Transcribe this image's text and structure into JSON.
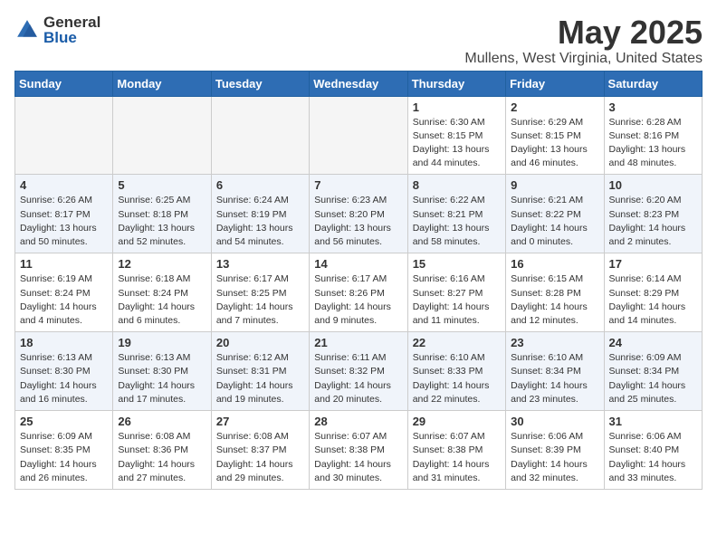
{
  "header": {
    "logo_general": "General",
    "logo_blue": "Blue",
    "month_title": "May 2025",
    "location": "Mullens, West Virginia, United States"
  },
  "days_of_week": [
    "Sunday",
    "Monday",
    "Tuesday",
    "Wednesday",
    "Thursday",
    "Friday",
    "Saturday"
  ],
  "weeks": [
    {
      "alt": false,
      "days": [
        {
          "num": "",
          "info": ""
        },
        {
          "num": "",
          "info": ""
        },
        {
          "num": "",
          "info": ""
        },
        {
          "num": "",
          "info": ""
        },
        {
          "num": "1",
          "info": "Sunrise: 6:30 AM\nSunset: 8:15 PM\nDaylight: 13 hours\nand 44 minutes."
        },
        {
          "num": "2",
          "info": "Sunrise: 6:29 AM\nSunset: 8:15 PM\nDaylight: 13 hours\nand 46 minutes."
        },
        {
          "num": "3",
          "info": "Sunrise: 6:28 AM\nSunset: 8:16 PM\nDaylight: 13 hours\nand 48 minutes."
        }
      ]
    },
    {
      "alt": true,
      "days": [
        {
          "num": "4",
          "info": "Sunrise: 6:26 AM\nSunset: 8:17 PM\nDaylight: 13 hours\nand 50 minutes."
        },
        {
          "num": "5",
          "info": "Sunrise: 6:25 AM\nSunset: 8:18 PM\nDaylight: 13 hours\nand 52 minutes."
        },
        {
          "num": "6",
          "info": "Sunrise: 6:24 AM\nSunset: 8:19 PM\nDaylight: 13 hours\nand 54 minutes."
        },
        {
          "num": "7",
          "info": "Sunrise: 6:23 AM\nSunset: 8:20 PM\nDaylight: 13 hours\nand 56 minutes."
        },
        {
          "num": "8",
          "info": "Sunrise: 6:22 AM\nSunset: 8:21 PM\nDaylight: 13 hours\nand 58 minutes."
        },
        {
          "num": "9",
          "info": "Sunrise: 6:21 AM\nSunset: 8:22 PM\nDaylight: 14 hours\nand 0 minutes."
        },
        {
          "num": "10",
          "info": "Sunrise: 6:20 AM\nSunset: 8:23 PM\nDaylight: 14 hours\nand 2 minutes."
        }
      ]
    },
    {
      "alt": false,
      "days": [
        {
          "num": "11",
          "info": "Sunrise: 6:19 AM\nSunset: 8:24 PM\nDaylight: 14 hours\nand 4 minutes."
        },
        {
          "num": "12",
          "info": "Sunrise: 6:18 AM\nSunset: 8:24 PM\nDaylight: 14 hours\nand 6 minutes."
        },
        {
          "num": "13",
          "info": "Sunrise: 6:17 AM\nSunset: 8:25 PM\nDaylight: 14 hours\nand 7 minutes."
        },
        {
          "num": "14",
          "info": "Sunrise: 6:17 AM\nSunset: 8:26 PM\nDaylight: 14 hours\nand 9 minutes."
        },
        {
          "num": "15",
          "info": "Sunrise: 6:16 AM\nSunset: 8:27 PM\nDaylight: 14 hours\nand 11 minutes."
        },
        {
          "num": "16",
          "info": "Sunrise: 6:15 AM\nSunset: 8:28 PM\nDaylight: 14 hours\nand 12 minutes."
        },
        {
          "num": "17",
          "info": "Sunrise: 6:14 AM\nSunset: 8:29 PM\nDaylight: 14 hours\nand 14 minutes."
        }
      ]
    },
    {
      "alt": true,
      "days": [
        {
          "num": "18",
          "info": "Sunrise: 6:13 AM\nSunset: 8:30 PM\nDaylight: 14 hours\nand 16 minutes."
        },
        {
          "num": "19",
          "info": "Sunrise: 6:13 AM\nSunset: 8:30 PM\nDaylight: 14 hours\nand 17 minutes."
        },
        {
          "num": "20",
          "info": "Sunrise: 6:12 AM\nSunset: 8:31 PM\nDaylight: 14 hours\nand 19 minutes."
        },
        {
          "num": "21",
          "info": "Sunrise: 6:11 AM\nSunset: 8:32 PM\nDaylight: 14 hours\nand 20 minutes."
        },
        {
          "num": "22",
          "info": "Sunrise: 6:10 AM\nSunset: 8:33 PM\nDaylight: 14 hours\nand 22 minutes."
        },
        {
          "num": "23",
          "info": "Sunrise: 6:10 AM\nSunset: 8:34 PM\nDaylight: 14 hours\nand 23 minutes."
        },
        {
          "num": "24",
          "info": "Sunrise: 6:09 AM\nSunset: 8:34 PM\nDaylight: 14 hours\nand 25 minutes."
        }
      ]
    },
    {
      "alt": false,
      "days": [
        {
          "num": "25",
          "info": "Sunrise: 6:09 AM\nSunset: 8:35 PM\nDaylight: 14 hours\nand 26 minutes."
        },
        {
          "num": "26",
          "info": "Sunrise: 6:08 AM\nSunset: 8:36 PM\nDaylight: 14 hours\nand 27 minutes."
        },
        {
          "num": "27",
          "info": "Sunrise: 6:08 AM\nSunset: 8:37 PM\nDaylight: 14 hours\nand 29 minutes."
        },
        {
          "num": "28",
          "info": "Sunrise: 6:07 AM\nSunset: 8:38 PM\nDaylight: 14 hours\nand 30 minutes."
        },
        {
          "num": "29",
          "info": "Sunrise: 6:07 AM\nSunset: 8:38 PM\nDaylight: 14 hours\nand 31 minutes."
        },
        {
          "num": "30",
          "info": "Sunrise: 6:06 AM\nSunset: 8:39 PM\nDaylight: 14 hours\nand 32 minutes."
        },
        {
          "num": "31",
          "info": "Sunrise: 6:06 AM\nSunset: 8:40 PM\nDaylight: 14 hours\nand 33 minutes."
        }
      ]
    }
  ]
}
